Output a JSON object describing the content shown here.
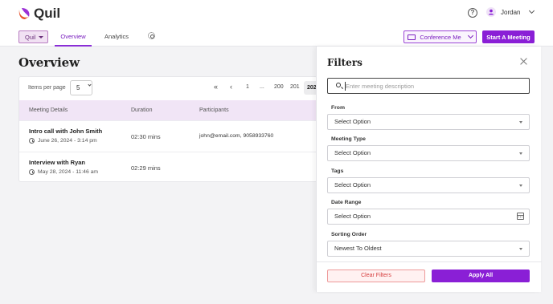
{
  "header": {
    "app_name": "Quil",
    "user_name": "Jordan",
    "org_select": "Quil",
    "tabs": [
      "Overview",
      "Analytics"
    ],
    "conference_label": "Conference Me",
    "start_meeting_label": "Start A Meeting",
    "brand_color": "#8a1fd6"
  },
  "overview": {
    "title": "Overview",
    "items_per_page_label": "Items per page",
    "items_per_page_value": "5",
    "pagination": {
      "first": "«",
      "prev": "‹",
      "pages": [
        "1",
        "...",
        "200",
        "201"
      ],
      "current": "202"
    },
    "columns": [
      "Meeting Details",
      "Duration",
      "Participants"
    ],
    "rows": [
      {
        "title": "Intro call with John Smith",
        "date": "June 26, 2024 - 3:14 pm",
        "duration": "02:30 mins",
        "participants": "john@email.com, 9058933760"
      },
      {
        "title": "Interview with Ryan",
        "date": "May 28, 2024 - 11:46 am",
        "duration": "02:29 mins",
        "participants": ""
      }
    ]
  },
  "filters": {
    "title": "Filters",
    "search_placeholder": "Enter meeting description",
    "fields": [
      {
        "label": "From",
        "value": "Select Option"
      },
      {
        "label": "Meeting Type",
        "value": "Select Option"
      },
      {
        "label": "Tags",
        "value": "Select Option"
      },
      {
        "label": "Date Range",
        "value": "Select Option"
      },
      {
        "label": "Sorting Order",
        "value": "Newest To Oldest"
      }
    ],
    "clear_label": "Clear Filters",
    "apply_label": "Apply All"
  }
}
